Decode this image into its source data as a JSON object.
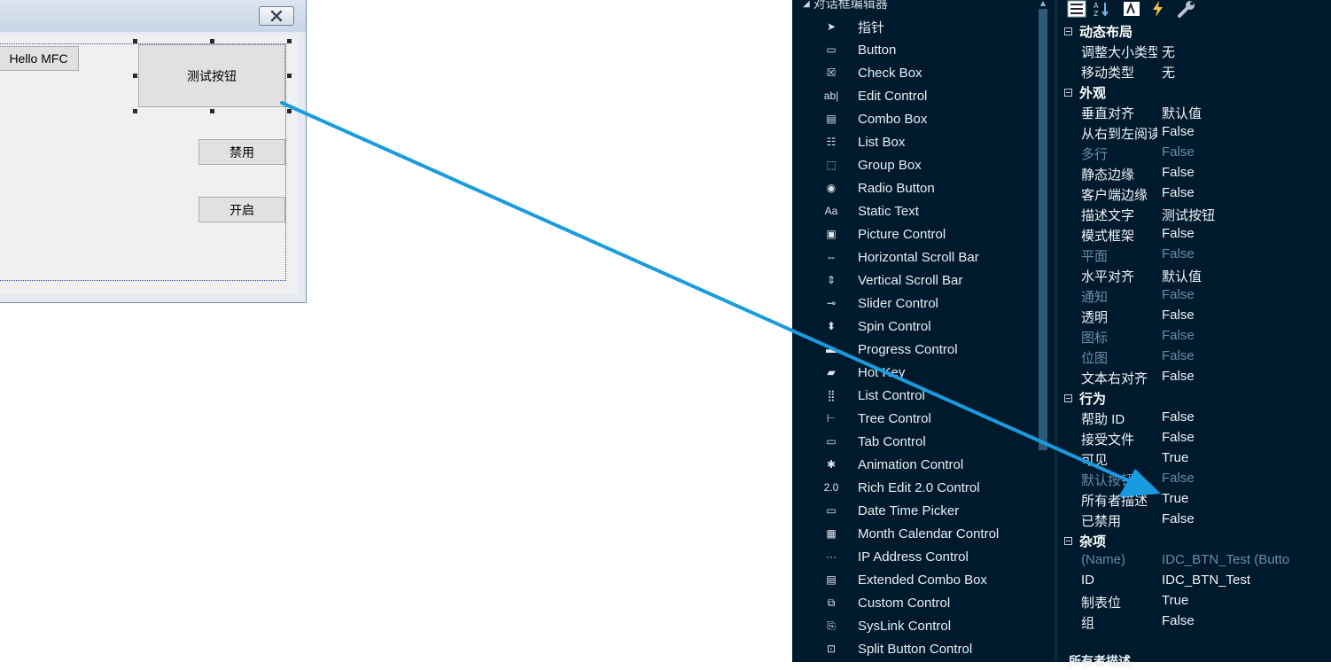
{
  "dialog": {
    "hello_button": "Hello MFC",
    "test_button": "测试按钮",
    "disable_button": "禁用",
    "enable_button": "开启"
  },
  "toolbox": {
    "header": "对话框编辑器",
    "items": [
      {
        "label": "指针",
        "icon": "pointer-icon"
      },
      {
        "label": "Button",
        "icon": "button-icon"
      },
      {
        "label": "Check Box",
        "icon": "checkbox-icon"
      },
      {
        "label": "Edit Control",
        "icon": "edit-control-icon"
      },
      {
        "label": "Combo Box",
        "icon": "combobox-icon"
      },
      {
        "label": "List Box",
        "icon": "listbox-icon"
      },
      {
        "label": "Group Box",
        "icon": "groupbox-icon"
      },
      {
        "label": "Radio Button",
        "icon": "radio-icon"
      },
      {
        "label": "Static Text",
        "icon": "static-text-icon"
      },
      {
        "label": "Picture Control",
        "icon": "picture-icon"
      },
      {
        "label": "Horizontal Scroll Bar",
        "icon": "hscroll-icon"
      },
      {
        "label": "Vertical Scroll Bar",
        "icon": "vscroll-icon"
      },
      {
        "label": "Slider Control",
        "icon": "slider-icon"
      },
      {
        "label": "Spin Control",
        "icon": "spin-icon"
      },
      {
        "label": "Progress Control",
        "icon": "progress-icon"
      },
      {
        "label": "Hot Key",
        "icon": "hotkey-icon"
      },
      {
        "label": "List Control",
        "icon": "listcontrol-icon"
      },
      {
        "label": "Tree Control",
        "icon": "tree-icon"
      },
      {
        "label": "Tab Control",
        "icon": "tab-icon"
      },
      {
        "label": "Animation Control",
        "icon": "animation-icon"
      },
      {
        "label": "Rich Edit 2.0 Control",
        "icon": "richedit-icon"
      },
      {
        "label": "Date Time Picker",
        "icon": "datetime-icon"
      },
      {
        "label": "Month Calendar Control",
        "icon": "calendar-icon"
      },
      {
        "label": "IP Address Control",
        "icon": "ipaddress-icon"
      },
      {
        "label": "Extended Combo Box",
        "icon": "extcombo-icon"
      },
      {
        "label": "Custom Control",
        "icon": "custom-icon"
      },
      {
        "label": "SysLink Control",
        "icon": "syslink-icon"
      },
      {
        "label": "Split Button Control",
        "icon": "splitbutton-icon"
      }
    ]
  },
  "properties": {
    "categories": [
      {
        "name": "动态布局",
        "rows": [
          {
            "name": "调整大小类型",
            "value": "无",
            "dim": false
          },
          {
            "name": "移动类型",
            "value": "无",
            "dim": false
          }
        ]
      },
      {
        "name": "外观",
        "rows": [
          {
            "name": "垂直对齐",
            "value": "默认值",
            "dim": false
          },
          {
            "name": "从右到左阅读",
            "value": "False",
            "dim": false
          },
          {
            "name": "多行",
            "value": "False",
            "dim": true
          },
          {
            "name": "静态边缘",
            "value": "False",
            "dim": false
          },
          {
            "name": "客户端边缘",
            "value": "False",
            "dim": false
          },
          {
            "name": "描述文字",
            "value": "测试按钮",
            "dim": false
          },
          {
            "name": "模式框架",
            "value": "False",
            "dim": false
          },
          {
            "name": "平面",
            "value": "False",
            "dim": true
          },
          {
            "name": "水平对齐",
            "value": "默认值",
            "dim": false
          },
          {
            "name": "通知",
            "value": "False",
            "dim": true
          },
          {
            "name": "透明",
            "value": "False",
            "dim": false
          },
          {
            "name": "图标",
            "value": "False",
            "dim": true
          },
          {
            "name": "位图",
            "value": "False",
            "dim": true
          },
          {
            "name": "文本右对齐",
            "value": "False",
            "dim": false
          }
        ]
      },
      {
        "name": "行为",
        "rows": [
          {
            "name": "帮助 ID",
            "value": "False",
            "dim": false
          },
          {
            "name": "接受文件",
            "value": "False",
            "dim": false
          },
          {
            "name": "可见",
            "value": "True",
            "dim": false
          },
          {
            "name": "默认按钮",
            "value": "False",
            "dim": true
          },
          {
            "name": "所有者描述",
            "value": "True",
            "dim": false
          },
          {
            "name": "已禁用",
            "value": "False",
            "dim": false
          }
        ]
      },
      {
        "name": "杂项",
        "rows": [
          {
            "name": "(Name)",
            "value": "IDC_BTN_Test (Butto",
            "dim": true
          },
          {
            "name": "ID",
            "value": "IDC_BTN_Test",
            "dim": false
          },
          {
            "name": "制表位",
            "value": "True",
            "dim": false
          },
          {
            "name": "组",
            "value": "False",
            "dim": false
          }
        ]
      }
    ],
    "description_title": "所有者描述"
  },
  "colors": {
    "panel_bg": "#001a2d",
    "arrow": "#1a9be0",
    "dim_text": "#6d8aa6"
  }
}
